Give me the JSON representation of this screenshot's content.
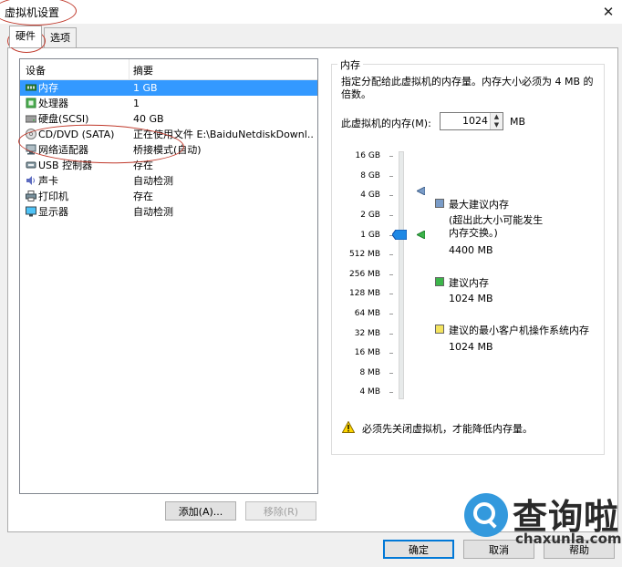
{
  "window": {
    "title": "虚拟机设置",
    "close": "✕"
  },
  "tabs": [
    {
      "label": "硬件"
    },
    {
      "label": "选项"
    }
  ],
  "device_list": {
    "columns": [
      "设备",
      "摘要"
    ],
    "rows": [
      {
        "name": "内存",
        "summary": "1 GB",
        "icon": "memory-icon",
        "selected": true
      },
      {
        "name": "处理器",
        "summary": "1",
        "icon": "processor-icon"
      },
      {
        "name": "硬盘(SCSI)",
        "summary": "40 GB",
        "icon": "harddisk-icon"
      },
      {
        "name": "CD/DVD (SATA)",
        "summary": "正在使用文件 E:\\BaiduNetdiskDownl...",
        "icon": "cd-dvd-icon"
      },
      {
        "name": "网络适配器",
        "summary": "桥接模式(自动)",
        "icon": "network-adapter-icon"
      },
      {
        "name": "USB 控制器",
        "summary": "存在",
        "icon": "usb-icon"
      },
      {
        "name": "声卡",
        "summary": "自动检测",
        "icon": "sound-card-icon"
      },
      {
        "name": "打印机",
        "summary": "存在",
        "icon": "printer-icon"
      },
      {
        "name": "显示器",
        "summary": "自动检测",
        "icon": "display-icon"
      }
    ]
  },
  "buttons": {
    "add": "添加(A)...",
    "remove": "移除(R)",
    "ok": "确定",
    "cancel": "取消",
    "help": "帮助"
  },
  "memory": {
    "group_title": "内存",
    "description": "指定分配给此虚拟机的内存量。内存大小必须为 4 MB 的倍数。",
    "field_label": "此虚拟机的内存(M):",
    "value": "1024",
    "unit": "MB",
    "scale": [
      "16 GB",
      "8 GB",
      "4 GB",
      "2 GB",
      "1 GB",
      "512 MB",
      "256 MB",
      "128 MB",
      "64 MB",
      "32 MB",
      "16 MB",
      "8 MB",
      "4 MB"
    ],
    "legend": [
      {
        "label": "最大建议内存",
        "note": "(超出此大小可能发生内存交换。)",
        "value": "4400 MB",
        "color": "#7a9cc8"
      },
      {
        "label": "建议内存",
        "value": "1024 MB",
        "color": "#3cb54a"
      },
      {
        "label": "建议的最小客户机操作系统内存",
        "value": "1024 MB",
        "color": "#f3e35e"
      }
    ],
    "warning": "必须先关闭虚拟机，才能降低内存量。"
  },
  "watermark": {
    "text": "查询啦",
    "url": "chaxunla.com"
  },
  "colors": {
    "selection": "#3399ff",
    "accent": "#0078d7",
    "annotation": "#c0392b"
  }
}
